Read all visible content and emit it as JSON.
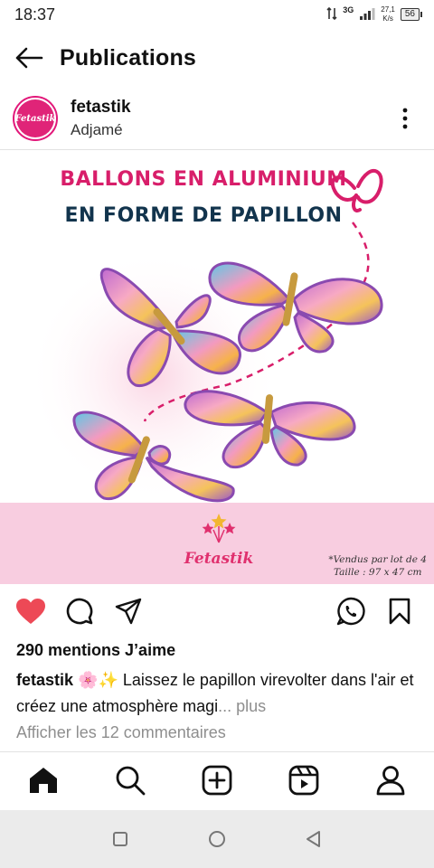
{
  "status_bar": {
    "time": "18:37",
    "network": "3G",
    "speed_value": "27,1",
    "speed_unit": "K/s",
    "battery": "56"
  },
  "header": {
    "title": "Publications"
  },
  "post": {
    "username": "fetastik",
    "location": "Adjamé",
    "avatar_text": "Fetastik",
    "image": {
      "title_line_1": "BALLONS EN ALUMINIUM",
      "title_line_2": "EN FORME DE PAPILLON",
      "brand": "Fetastik",
      "note_line_1": "*Vendus par lot de 4",
      "note_line_2": "Taille : 97 x 47 cm"
    },
    "likes": "290 mentions J’aime",
    "caption_user": "fetastik",
    "caption_emoji": "🌸✨",
    "caption_text": " Laissez le papillon virevolter dans l'air et créez une atmosphère magi",
    "caption_more": "... plus",
    "comments_link": "Afficher les 12 commentaires"
  },
  "colors": {
    "like_red": "#ed4956",
    "brand_pink": "#e02478",
    "band_pink": "#f8cde0",
    "muted_text": "#8e8e8e"
  },
  "icons": {
    "back": "arrow-left-icon",
    "more": "three-dots-vertical-icon",
    "like": "heart-filled-icon",
    "comment": "speech-bubble-icon",
    "share": "paper-plane-icon",
    "whatsapp": "whatsapp-icon",
    "save": "bookmark-icon",
    "home": "home-icon",
    "search": "search-icon",
    "create": "plus-square-icon",
    "reels": "reels-icon",
    "profile": "person-icon"
  }
}
